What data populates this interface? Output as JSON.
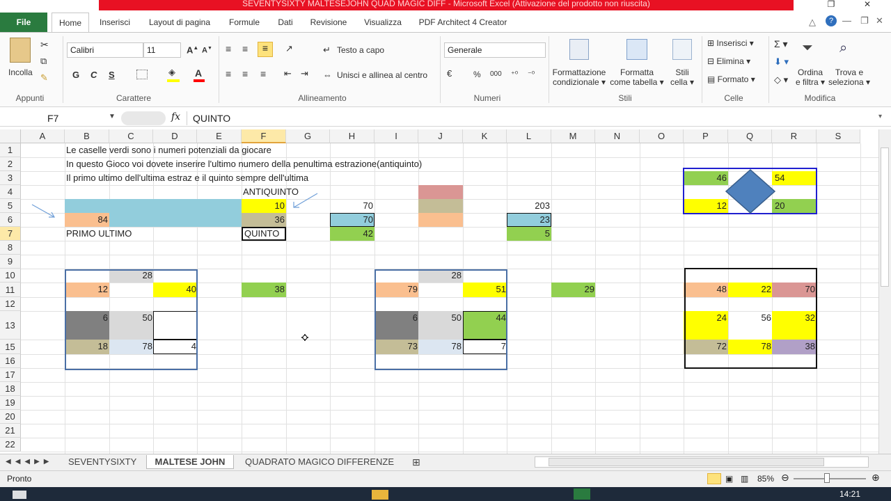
{
  "window": {
    "title": "SEVENTYSIXTY MALTESEJOHN QUAD MAGIC DIFF - Microsoft Excel (Attivazione del prodotto non riuscita)"
  },
  "tabs": [
    "File",
    "Home",
    "Inserisci",
    "Layout di pagina",
    "Formule",
    "Dati",
    "Revisione",
    "Visualizza",
    "PDF Architect 4 Creator"
  ],
  "ribbon": {
    "paste": "Incolla",
    "group_appunti": "Appunti",
    "font_name": "Calibri",
    "font_size": "11",
    "bold": "G",
    "italic": "C",
    "underline": "S",
    "group_carattere": "Carattere",
    "wrap_text": "Testo a capo",
    "merge": "Unisci e allinea al centro",
    "group_allineamento": "Allineamento",
    "number_format": "Generale",
    "percent": "%",
    "thousands": "000",
    "group_numeri": "Numeri",
    "cond_format": [
      "Formattazione",
      "condizionale"
    ],
    "format_table": [
      "Formatta",
      "come tabella"
    ],
    "cell_styles": [
      "Stili",
      "cella"
    ],
    "group_stili": "Stili",
    "insert": "Inserisci",
    "delete": "Elimina",
    "format": "Formato",
    "group_celle": "Celle",
    "sort": [
      "Ordina",
      "e filtra"
    ],
    "find": [
      "Trova e",
      "seleziona"
    ],
    "group_modifica": "Modifica"
  },
  "formula_bar": {
    "cell_ref": "F7",
    "fx": "fx",
    "value": "QUINTO"
  },
  "columns": [
    "A",
    "B",
    "C",
    "D",
    "E",
    "F",
    "G",
    "H",
    "I",
    "J",
    "K",
    "L",
    "M",
    "N",
    "O",
    "P",
    "Q",
    "R",
    "S"
  ],
  "rows": [
    "1",
    "2",
    "3",
    "4",
    "5",
    "6",
    "7",
    "8",
    "9",
    "10",
    "11",
    "12",
    "13",
    "15",
    "16",
    "17",
    "18",
    "19",
    "20",
    "21",
    "22"
  ],
  "cells": {
    "b1": "Le caselle verdi sono i numeri potenziali da giocare",
    "b2": "In questo Gioco voi dovete inserire l'ultimo numero della penultima estrazione(antiquinto)",
    "b3": "Il primo ultimo dell'ultima estraz e il quinto sempre dell'ultima",
    "f4": "ANTIQUINTO",
    "f5": "10",
    "h5": "70",
    "l5": "203",
    "b6": "84",
    "f6": "36",
    "h6": "70",
    "l6": "23",
    "b7": "PRIMO ULTIMO",
    "f7": "QUINTO",
    "h7": "42",
    "l7": "5",
    "c10": "28",
    "b11": "12",
    "d11": "40",
    "f11": "38",
    "b13": "6",
    "c13": "50",
    "b15": "18",
    "c15": "78",
    "d15": "4",
    "j10": "28",
    "i11": "79",
    "k11": "51",
    "m11": "29",
    "i13": "6",
    "j13": "50",
    "k13": "44",
    "i15": "73",
    "j15": "78",
    "k15": "7",
    "p3": "46",
    "r3": "54",
    "p5": "12",
    "r5": "20",
    "p11": "48",
    "q11": "22",
    "r11": "70",
    "p13": "24",
    "q13": "56",
    "r13": "32",
    "p15": "72",
    "q15": "78",
    "r15": "38"
  },
  "sheets": [
    "SEVENTYSIXTY",
    "MALTESE JOHN",
    "QUADRATO MAGICO DIFFERENZE"
  ],
  "active_sheet": "MALTESE JOHN",
  "status": {
    "ready": "Pronto",
    "zoom": "85%"
  },
  "taskbar": {
    "clock": "14:21"
  },
  "colors": {
    "green": "#92d050",
    "yellow": "#ffff00",
    "teal": "#92cddc",
    "peach": "#fabf8f",
    "tan": "#c4bd97",
    "rose": "#da9694",
    "gray": "#808080",
    "lightgray": "#d9d9d9",
    "lightblue": "#dce6f1",
    "lavender": "#b1a0c7",
    "blue_border": "#2f5597"
  }
}
